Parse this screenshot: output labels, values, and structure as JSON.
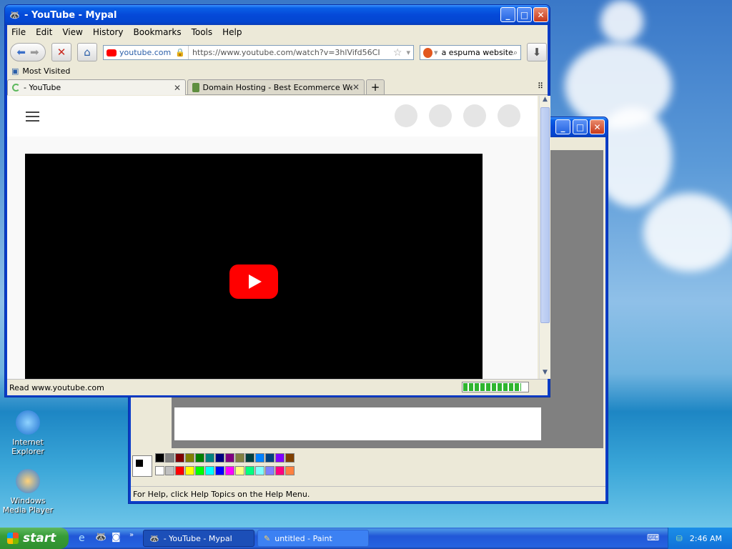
{
  "firefox": {
    "title": "- YouTube - Mypal",
    "menu": [
      "File",
      "Edit",
      "View",
      "History",
      "Bookmarks",
      "Tools",
      "Help"
    ],
    "identity": "youtube.com",
    "url": "https://www.youtube.com/watch?v=3hlVifd56CI",
    "search": "a espuma website",
    "bookmark": "Most Visited",
    "tabs": [
      {
        "label": "- YouTube"
      },
      {
        "label": "Domain Hosting - Best Ecommerce Web H..."
      }
    ],
    "status": "Read www.youtube.com",
    "progress": 0.9
  },
  "paint": {
    "status": "For Help, click Help Topics on the Help Menu.",
    "palette_top": [
      "#000000",
      "#808080",
      "#800000",
      "#808000",
      "#008000",
      "#008080",
      "#000080",
      "#800080",
      "#808040",
      "#004040",
      "#0080ff",
      "#004080",
      "#8000ff",
      "#804000"
    ],
    "palette_bottom": [
      "#ffffff",
      "#c0c0c0",
      "#ff0000",
      "#ffff00",
      "#00ff00",
      "#00ffff",
      "#0000ff",
      "#ff00ff",
      "#ffff80",
      "#00ff80",
      "#80ffff",
      "#8080ff",
      "#ff0080",
      "#ff8040"
    ]
  },
  "desktop": {
    "icons": [
      {
        "label": "Internet Explorer"
      },
      {
        "label": "Windows Media Player"
      }
    ]
  },
  "taskbar": {
    "start": "start",
    "items": [
      {
        "label": "- YouTube - Mypal"
      },
      {
        "label": "untitled - Paint"
      }
    ],
    "clock": "2:46 AM"
  }
}
